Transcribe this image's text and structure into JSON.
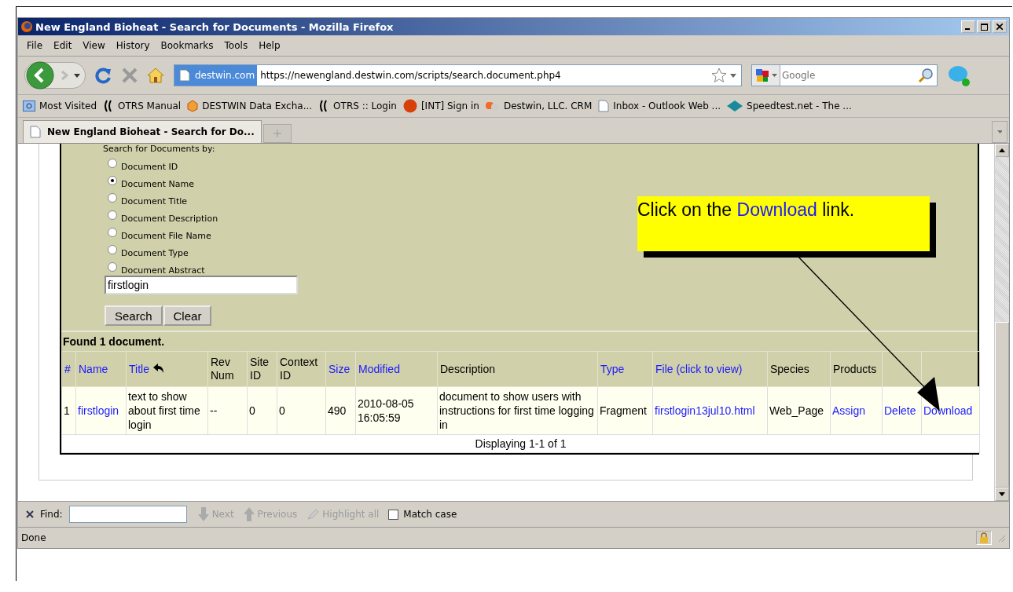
{
  "window": {
    "title": "New England Bioheat - Search for Documents - Mozilla Firefox"
  },
  "menu": [
    "File",
    "Edit",
    "View",
    "History",
    "Bookmarks",
    "Tools",
    "Help"
  ],
  "navigation": {
    "site_badge": "destwin.com",
    "url": "https://newengland.destwin.com/scripts/search.document.php4",
    "search_placeholder": "Google"
  },
  "bookmarks": [
    {
      "label": "Most Visited",
      "kind": "folder"
    },
    {
      "label": "OTRS Manual",
      "kind": "otrs"
    },
    {
      "label": "DESTWIN Data Excha...",
      "kind": "cube"
    },
    {
      "label": "OTRS :: Login",
      "kind": "otrs"
    },
    {
      "label": "[INT] Sign in",
      "kind": "ball"
    },
    {
      "label": "Destwin, LLC. CRM",
      "kind": "crm"
    },
    {
      "label": "Inbox - Outlook Web ...",
      "kind": "page"
    },
    {
      "label": "Speedtest.net - The ...",
      "kind": "diamond"
    }
  ],
  "tabs": [
    {
      "label": "New England Bioheat - Search for Do...",
      "selected": true
    }
  ],
  "form": {
    "heading": "Search for Documents by:",
    "options": [
      {
        "label": "Document ID",
        "selected": false
      },
      {
        "label": "Document Name",
        "selected": true
      },
      {
        "label": "Document Title",
        "selected": false
      },
      {
        "label": "Document Description",
        "selected": false
      },
      {
        "label": "Document File Name",
        "selected": false
      },
      {
        "label": "Document Type",
        "selected": false
      },
      {
        "label": "Document Abstract",
        "selected": false
      }
    ],
    "query": "firstlogin",
    "buttons": [
      "Search",
      "Clear"
    ]
  },
  "results": {
    "found": "Found 1 document.",
    "columns": [
      {
        "label": "#",
        "link": true,
        "sorted": false
      },
      {
        "label": "Name",
        "link": true,
        "sorted": false
      },
      {
        "label": "Title",
        "link": true,
        "sorted": true
      },
      {
        "label": "Rev Num",
        "link": false,
        "sorted": false
      },
      {
        "label": "Site ID",
        "link": false,
        "sorted": false
      },
      {
        "label": "Context ID",
        "link": false,
        "sorted": false
      },
      {
        "label": "Size",
        "link": true,
        "sorted": false
      },
      {
        "label": "Modified",
        "link": true,
        "sorted": false
      },
      {
        "label": "Description",
        "link": false,
        "sorted": false
      },
      {
        "label": "Type",
        "link": true,
        "sorted": false
      },
      {
        "label": "File (click to view)",
        "link": true,
        "sorted": false
      },
      {
        "label": "Species",
        "link": false,
        "sorted": false
      },
      {
        "label": "Products",
        "link": false,
        "sorted": false
      }
    ],
    "rows": [
      {
        "cells": [
          {
            "text": "1",
            "link": false
          },
          {
            "text": "firstlogin",
            "link": true
          },
          {
            "text": "text to show about first time login",
            "link": false
          },
          {
            "text": "--",
            "link": false
          },
          {
            "text": "0",
            "link": false
          },
          {
            "text": "0",
            "link": false
          },
          {
            "text": "490",
            "link": false
          },
          {
            "text": "2010-08-05 16:05:59",
            "link": false
          },
          {
            "text": "document to show users with instructions for first time logging in",
            "link": false
          },
          {
            "text": "Fragment",
            "link": false
          },
          {
            "text": "firstlogin13jul10.html",
            "link": true
          },
          {
            "text": "Web_Page",
            "link": false
          },
          {
            "text": "Assign",
            "link": true
          },
          {
            "text": "Delete",
            "link": true
          },
          {
            "text": "Download",
            "link": true
          }
        ]
      }
    ],
    "footer": "Displaying 1-1 of 1"
  },
  "callout": {
    "before": "Click on the ",
    "link": "Download",
    "after": " link."
  },
  "find_bar": {
    "label": "Find:",
    "buttons": [
      {
        "label": "Next",
        "kind": "next",
        "disabled": true
      },
      {
        "label": "Previous",
        "kind": "previous",
        "disabled": true
      },
      {
        "label": "Highlight all",
        "kind": "highlight",
        "disabled": true
      }
    ],
    "match_case": {
      "label": "Match case",
      "checked": false
    }
  },
  "status_bar": {
    "text": "Done"
  }
}
